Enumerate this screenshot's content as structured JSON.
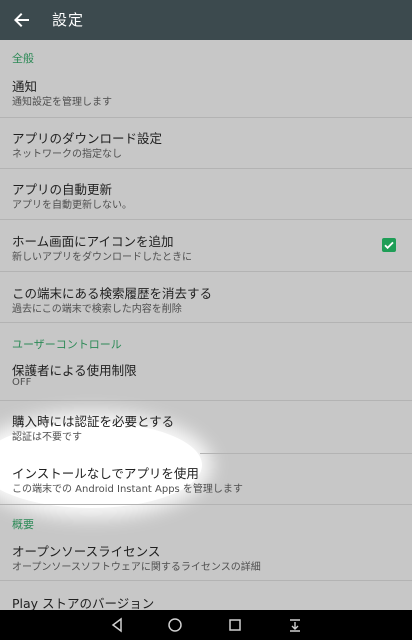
{
  "header": {
    "title": "設定"
  },
  "sections": {
    "general": "全般",
    "user_control": "ユーザーコントロール",
    "about": "概要"
  },
  "items": {
    "notifications": {
      "title": "通知",
      "subtitle": "通知設定を管理します"
    },
    "download": {
      "title": "アプリのダウンロード設定",
      "subtitle": "ネットワークの指定なし"
    },
    "auto_update": {
      "title": "アプリの自動更新",
      "subtitle": "アプリを自動更新しない。"
    },
    "home_icon": {
      "title": "ホーム画面にアイコンを追加",
      "subtitle": "新しいアプリをダウンロードしたときに",
      "checked": true
    },
    "clear_history": {
      "title": "この端末にある検索履歴を消去する",
      "subtitle": "過去にこの端末で検索した内容を削除"
    },
    "parental": {
      "title": "保護者による使用制限",
      "subtitle": "OFF"
    },
    "auth": {
      "title": "購入時には認証を必要とする",
      "subtitle": "認証は不要です"
    },
    "instant": {
      "title": "インストールなしでアプリを使用",
      "subtitle": "この端末での Android Instant Apps を管理します"
    },
    "oss": {
      "title": "オープンソースライセンス",
      "subtitle": "オープンソースソフトウェアに関するライセンスの詳細"
    },
    "version": {
      "title": "Play ストアのバージョン"
    }
  },
  "icons": {
    "back": "arrow-back-icon",
    "check": "check-icon",
    "nav_back": "triangle-back-icon",
    "nav_home": "circle-home-icon",
    "nav_recents": "square-recents-icon",
    "nav_extra": "download-icon"
  },
  "colors": {
    "appbar": "#3c4a4e",
    "section": "#2d8a57",
    "checkbox": "#1f9e57",
    "background": "#c7c7c7"
  }
}
